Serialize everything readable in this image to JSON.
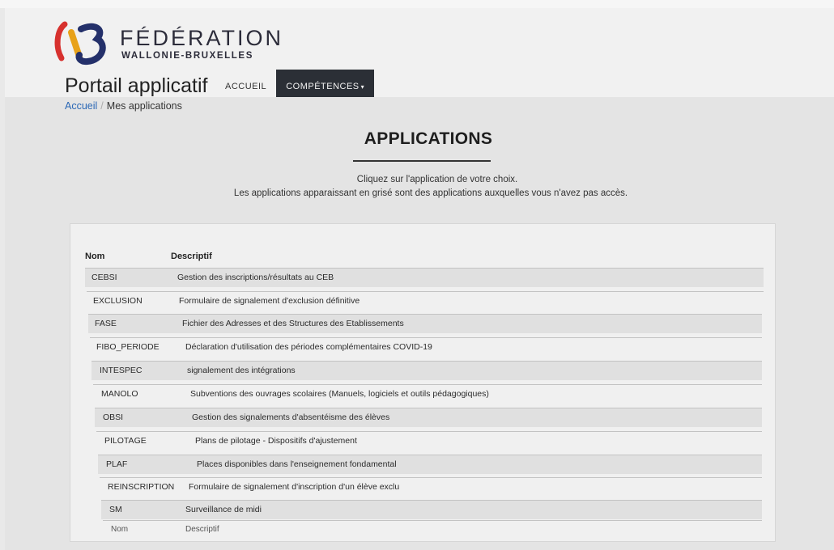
{
  "brand": {
    "title": "FÉDÉRATION",
    "subtitle": "WALLONIE-BRUXELLES"
  },
  "portal_title": "Portail applicatif",
  "nav": [
    {
      "label": "ACCUEIL",
      "active": false
    },
    {
      "label": "COMPÉTENCES",
      "active": true,
      "caret": "▾"
    }
  ],
  "breadcrumb": {
    "home": "Accueil",
    "separator": "/",
    "current": "Mes applications"
  },
  "heading": "APPLICATIONS",
  "intro": [
    "Cliquez sur l'application de votre choix.",
    "Les applications apparaissant en grisé sont des applications auxquelles vous n'avez pas accès."
  ],
  "table": {
    "headers": [
      "Nom",
      "Descriptif"
    ],
    "rows": [
      {
        "nom": "CEBSI",
        "desc": "Gestion des inscriptions/résultats au CEB"
      },
      {
        "nom": "EXCLUSION",
        "desc": "Formulaire de signalement d'exclusion définitive"
      },
      {
        "nom": "FASE",
        "desc": "Fichier des Adresses et des Structures des Etablissements"
      },
      {
        "nom": "FIBO_PERIODE",
        "desc": "Déclaration d'utilisation des périodes complémentaires COVID-19"
      },
      {
        "nom": "INTESPEC",
        "desc": "signalement des intégrations"
      },
      {
        "nom": "MANOLO",
        "desc": "Subventions des ouvrages scolaires (Manuels, logiciels et outils pédagogiques)"
      },
      {
        "nom": "OBSI",
        "desc": "Gestion des signalements d'absentéisme des élèves"
      },
      {
        "nom": "PILOTAGE",
        "desc": "Plans de pilotage - Dispositifs d'ajustement"
      },
      {
        "nom": "PLAF",
        "desc": "Places disponibles dans l'enseignement fondamental"
      },
      {
        "nom": "REINSCRIPTION",
        "desc": "Formulaire de signalement d'inscription d'un élève exclu"
      },
      {
        "nom": "SM",
        "desc": "Surveillance de midi"
      }
    ],
    "footer": [
      "Nom",
      "Descriptif"
    ]
  },
  "colors": {
    "nav_active_bg": "#2b2f36",
    "link": "#2a67b5",
    "logo_orange": "#e8a21a",
    "logo_red": "#d7312e",
    "logo_blue": "#24306a"
  }
}
